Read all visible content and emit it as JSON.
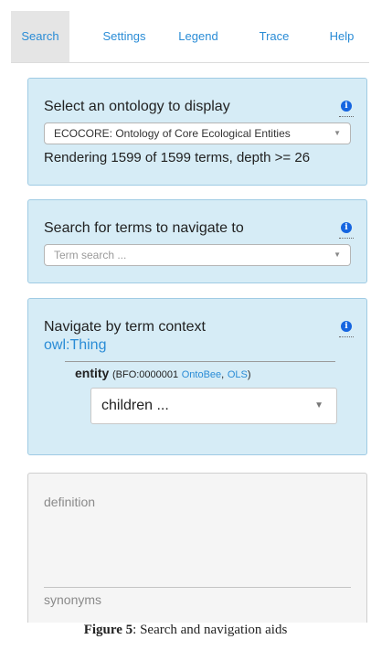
{
  "tabs": [
    {
      "label": "Search",
      "active": true
    },
    {
      "label": "Settings"
    },
    {
      "label": "Legend"
    },
    {
      "label": "Trace"
    },
    {
      "label": "Help"
    }
  ],
  "ontology_panel": {
    "title": "Select an ontology to display",
    "selected_value": "ECOCORE: Ontology of Core Ecological Entities",
    "rendering_text": "Rendering 1599 of 1599 terms, depth >= 26"
  },
  "search_panel": {
    "title": "Search for terms to navigate to",
    "placeholder": "Term search ..."
  },
  "navigate_panel": {
    "title": "Navigate by term context",
    "root_term": "owl:Thing",
    "entity_label": "entity",
    "entity_id_prefix": "(BFO:0000001",
    "link_ontobee": "OntoBee",
    "separator": ",",
    "link_ols": "OLS",
    "entity_id_suffix": ")",
    "children_select": "children ..."
  },
  "detail_panel": {
    "definition_label": "definition",
    "synonyms_label": "synonyms"
  },
  "info_icon_glyph": "i",
  "caption": {
    "figure_label": "Figure 5",
    "text": ": Search and navigation aids"
  },
  "colors": {
    "accent": "#2a8cd6",
    "panel_bg": "#d6ecf6",
    "info_icon": "#1565e0"
  }
}
